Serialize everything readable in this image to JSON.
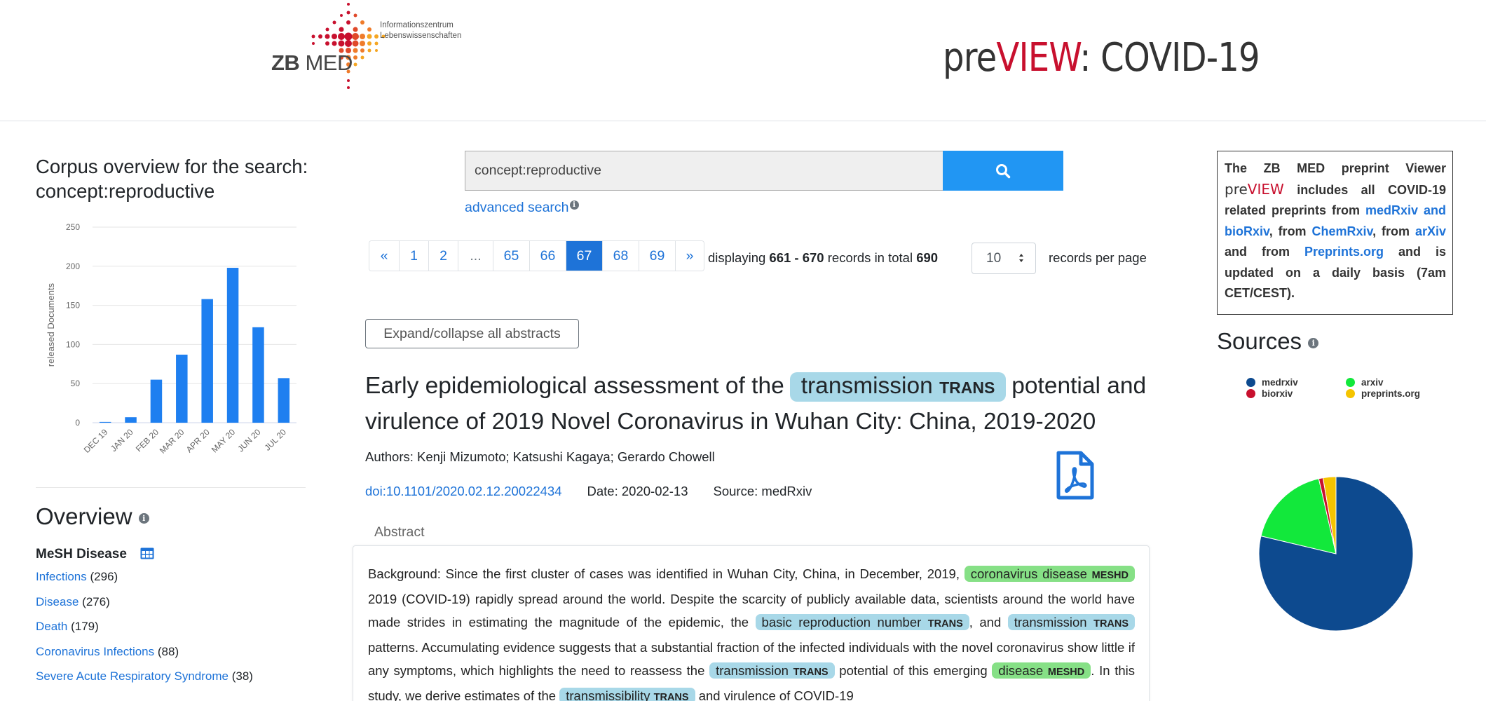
{
  "header": {
    "logo_text_zb": "ZB",
    "logo_text_med": "MED",
    "logo_sub_1": "Informationszentrum",
    "logo_sub_2": "Lebenswissenschaften",
    "title_pre": "pre",
    "title_view": "VIEW",
    "title_rest": ": COVID-19"
  },
  "corpus": {
    "title": "Corpus overview for the search: concept:reproductive"
  },
  "chart_data": {
    "type": "bar",
    "categories": [
      "DEC 19",
      "JAN 20",
      "FEB 20",
      "MAR 20",
      "APR 20",
      "MAY 20",
      "JUN 20",
      "JUL 20"
    ],
    "values": [
      1,
      7,
      55,
      87,
      158,
      198,
      122,
      57
    ],
    "ylabel": "released Documents",
    "ylim": [
      0,
      250
    ],
    "yticks": [
      0,
      50,
      100,
      150,
      200,
      250
    ],
    "grid": true,
    "color": "#1e7ff0"
  },
  "overview": {
    "title": "Overview",
    "mesh_title": "MeSH Disease",
    "items": [
      {
        "label": "Infections",
        "count": "(296)"
      },
      {
        "label": "Disease",
        "count": "(276)"
      },
      {
        "label": "Death",
        "count": "(179)"
      },
      {
        "label": "Coronavirus Infections",
        "count": "(88)"
      },
      {
        "label": "Severe Acute Respiratory Syndrome",
        "count": "(38)"
      }
    ]
  },
  "search": {
    "query": "concept:reproductive",
    "advanced_label": "advanced search"
  },
  "pagination": {
    "pages": [
      {
        "label": "«"
      },
      {
        "label": "1"
      },
      {
        "label": "2"
      },
      {
        "label": "..."
      },
      {
        "label": "65"
      },
      {
        "label": "66"
      },
      {
        "label": "67"
      },
      {
        "label": "68"
      },
      {
        "label": "69"
      },
      {
        "label": "»"
      }
    ],
    "active": "67",
    "display_prefix": "displaying ",
    "display_range": "661 - 670",
    "display_mid": " records in total ",
    "display_total": "690",
    "per_page": "10",
    "per_page_label": "records per page"
  },
  "results": {
    "expand_label": "Expand/collapse all abstracts",
    "title_part1": "Early epidemiological assessment of the",
    "title_tag": "transmission",
    "title_tag_type": "TRANS",
    "title_part2": "potential and virulence of 2019 Novel Coronavirus in Wuhan City: China, 2019-2020",
    "authors": "Authors: Kenji Mizumoto; Katsushi Kagaya; Gerardo Chowell",
    "doi": "doi:10.1101/2020.02.12.20022434",
    "date": "Date: 2020-02-13",
    "source": "Source: medRxiv",
    "abstract_tab": "Abstract",
    "abstract": {
      "t1": "Background: Since the first cluster of cases was identified in Wuhan City, China, in December, 2019,",
      "h1": "coronavirus disease",
      "h1_type": "MESHD",
      "t2": "2019 (COVID-19) rapidly spread around the world. Despite the scarcity of publicly available data, scientists around the world have made strides in estimating the magnitude of the epidemic, the",
      "h2": "basic reproduction number",
      "h2_type": "TRANS",
      "t3": ", and",
      "h3": "transmission",
      "h3_type": "TRANS",
      "t4": "patterns. Accumulating evidence suggests that a substantial fraction of the infected individuals with the novel coronavirus show little if any symptoms, which highlights the need to reassess the",
      "h4": "transmission",
      "h4_type": "TRANS",
      "t5": "potential of this emerging",
      "h5": "disease",
      "h5_type": "MESHD",
      "t6": ". In this study, we derive estimates of the",
      "h6": "transmissibility",
      "h6_type": "TRANS",
      "t7": "and virulence of COVID-19"
    }
  },
  "info": {
    "p1": "The ZB MED preprint Viewer",
    "pv_pre": "pre",
    "pv_view": "VIEW",
    "p2": "includes all COVID-19 related preprints from",
    "link1": "medRxiv and bioRxiv",
    "p3": ", from",
    "link2": "ChemRxiv",
    "p4": ", from",
    "link3": "arXiv",
    "p5": "and from",
    "link4": "Preprints.org",
    "p6": "and is updated on a daily basis (7am CET/CEST)."
  },
  "sources": {
    "title": "Sources",
    "legend": [
      {
        "name": "medrxiv",
        "color": "#0d4a8f"
      },
      {
        "name": "arxiv",
        "color": "#12e83b"
      },
      {
        "name": "biorxiv",
        "color": "#c8102e"
      },
      {
        "name": "preprints.org",
        "color": "#f5c400"
      }
    ],
    "pie_fractions": [
      {
        "name": "medrxiv",
        "value": 0.787,
        "color": "#0d4a8f"
      },
      {
        "name": "arxiv",
        "value": 0.177,
        "color": "#12e83b"
      },
      {
        "name": "biorxiv",
        "value": 0.009,
        "color": "#c8102e"
      },
      {
        "name": "preprints.org",
        "value": 0.027,
        "color": "#f5c400"
      }
    ]
  },
  "icons": [
    "search-icon",
    "info-icon",
    "table-icon",
    "pdf-icon",
    "select-arrows-icon"
  ]
}
